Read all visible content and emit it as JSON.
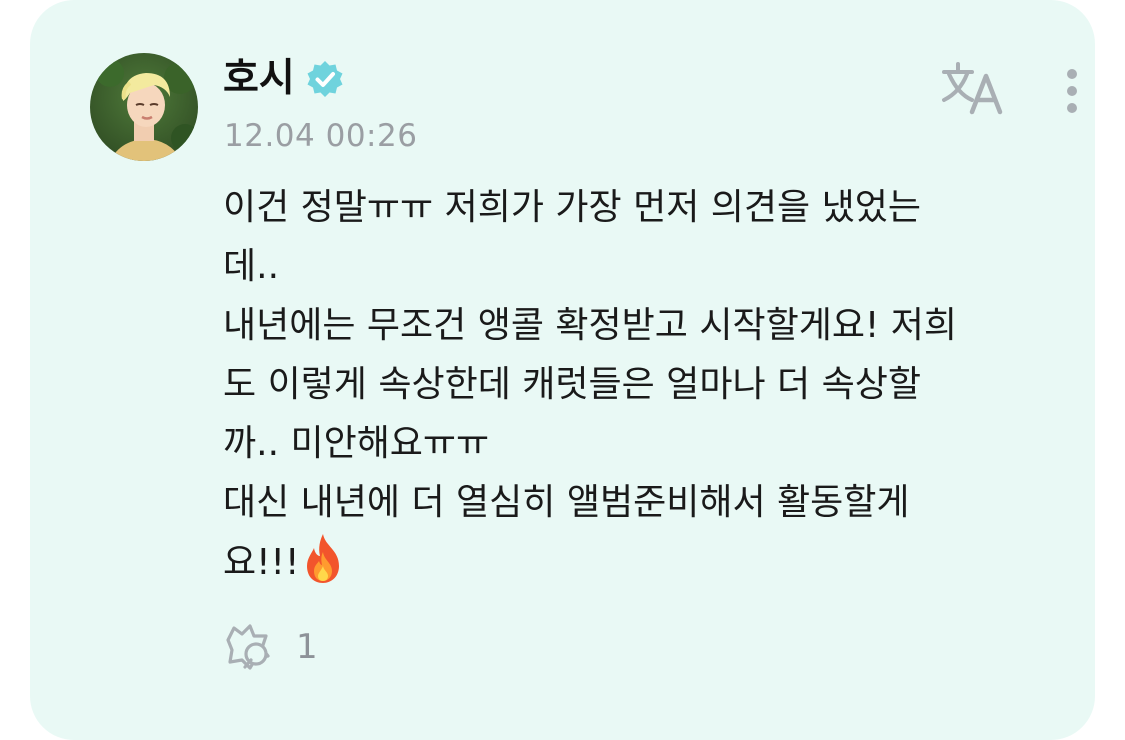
{
  "post": {
    "author": "호시",
    "timestamp": "12.04 00:26",
    "body_lines": [
      "이건 정말ㅠㅠ 저희가 가장 먼저 의견을 냈었는",
      "데..",
      "내년에는 무조건 앵콜 확정받고 시작할게요! 저희",
      "도 이렇게 속상한데 캐럿들은 얼마나 더 속상할",
      "까.. 미안해요ㅠㅠ",
      "대신 내년에 더 열심히 앨범준비해서 활동할게",
      "요!!!"
    ],
    "reaction_count": "1"
  },
  "icons": {
    "verified": "verified-badge-icon",
    "translate": "translate-icon",
    "more": "more-vertical-icon",
    "reaction": "add-reaction-icon",
    "emoji": "fire-emoji"
  },
  "colors": {
    "card_background": "#e9f9f5",
    "verified_badge": "#6fd3dd",
    "timestamp": "#9a9ea3",
    "icon_gray": "#a9afb4"
  }
}
